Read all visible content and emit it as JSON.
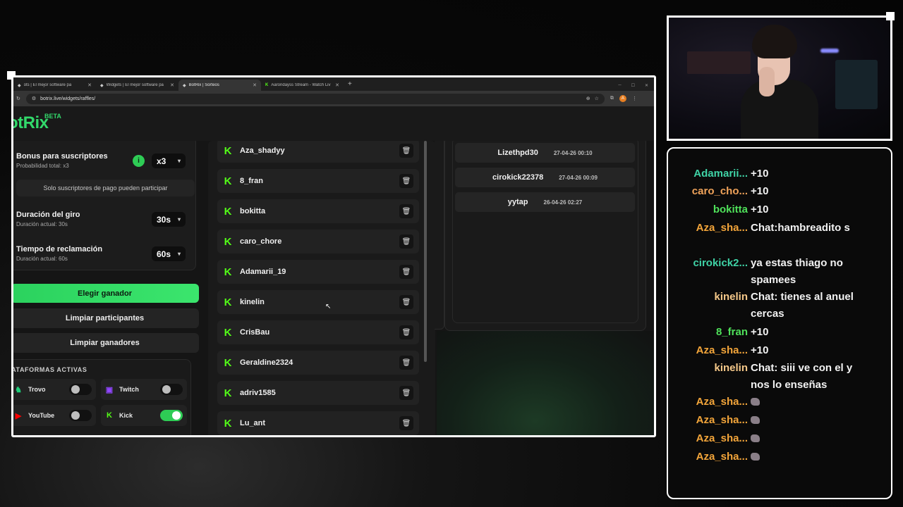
{
  "browser": {
    "tabs": [
      {
        "label": "ots | El mejor software pa",
        "icon": "botrix-icon",
        "active": false
      },
      {
        "label": "Widgets | El mejor software pa",
        "icon": "botrix-icon",
        "active": false
      },
      {
        "label": "BotRix | Sorteos",
        "icon": "botrix-icon",
        "active": true
      },
      {
        "label": "Aarondayss Stream - Watch Liv",
        "icon": "kick-icon",
        "active": false
      }
    ],
    "new_tab": "+",
    "url": "botrix.live/widgets/raffles/",
    "profile_initial": "A"
  },
  "app": {
    "logo": "otRix",
    "logo_badge": "BETA",
    "settings": {
      "subscriber_bonus": {
        "label": "Bonus para suscriptores",
        "sub": "Probabilidad total: x3",
        "value": "x3"
      },
      "notice": "Solo suscriptores de pago pueden participar",
      "spin_duration": {
        "label": "Duración del giro",
        "sub": "Duración actual: 30s",
        "value": "30s"
      },
      "claim_time": {
        "label": "Tiempo de reclamación",
        "sub": "Duración actual: 60s",
        "value": "60s"
      }
    },
    "buttons": {
      "pick_winner": "Elegir ganador",
      "clear_participants": "Limpiar participantes",
      "clear_winners": "Limpiar ganadores"
    },
    "platforms": {
      "title": "LATAFORMAS ACTIVAS",
      "items": [
        {
          "name": "Trovo",
          "icon": "trovo-icon",
          "enabled": false,
          "color": "#1fcf7a"
        },
        {
          "name": "Twitch",
          "icon": "twitch-icon",
          "enabled": false,
          "color": "#9146ff"
        },
        {
          "name": "YouTube",
          "icon": "youtube-icon",
          "enabled": false,
          "color": "#ff0000"
        },
        {
          "name": "Kick",
          "icon": "kick-icon",
          "enabled": true,
          "color": "#53fc18"
        }
      ]
    },
    "participants": [
      "Aza_shadyy",
      "8_fran",
      "bokitta",
      "caro_chore",
      "Adamarii_19",
      "kinelin",
      "CrisBau",
      "Geraldine2324",
      "adriv1585",
      "Lu_ant"
    ],
    "winners": [
      {
        "name": "Lizethpd30",
        "date": "27-04-26 00:10"
      },
      {
        "name": "cirokick22378",
        "date": "27-04-26 00:09"
      },
      {
        "name": "yytap",
        "date": "26-04-26 02:27"
      }
    ]
  },
  "chat": {
    "messages": [
      {
        "user": "Adamarii...",
        "color": "#3fd3a6",
        "text": "+10"
      },
      {
        "user": "caro_cho...",
        "color": "#f0a35a",
        "text": "+10"
      },
      {
        "user": "bokitta",
        "color": "#4fe15a",
        "text": "+10"
      },
      {
        "user": "Aza_sha...",
        "color": "#f3a53a",
        "text": "Chat:hambreadito s"
      },
      {
        "user": "cirokick2...",
        "color": "#3fd3a6",
        "text": "ya estas thiago no spamees"
      },
      {
        "user": "kinelin",
        "color": "#f6c98a",
        "text": "Chat: tienes al anuel cercas"
      },
      {
        "user": "8_fran",
        "color": "#4fe15a",
        "text": "+10"
      },
      {
        "user": "Aza_sha...",
        "color": "#f3a53a",
        "text": "+10"
      },
      {
        "user": "kinelin",
        "color": "#f6c98a",
        "text": "Chat: siii ve con el y nos lo enseñas"
      },
      {
        "user": "Aza_sha...",
        "color": "#f3a53a",
        "text": "",
        "emote": true
      },
      {
        "user": "Aza_sha...",
        "color": "#f3a53a",
        "text": "",
        "emote": true
      },
      {
        "user": "Aza_sha...",
        "color": "#f3a53a",
        "text": "",
        "emote": true
      },
      {
        "user": "Aza_sha...",
        "color": "#f3a53a",
        "text": "",
        "emote": true
      }
    ]
  },
  "colors": {
    "accent": "#2ecc55",
    "kick": "#53fc18"
  }
}
